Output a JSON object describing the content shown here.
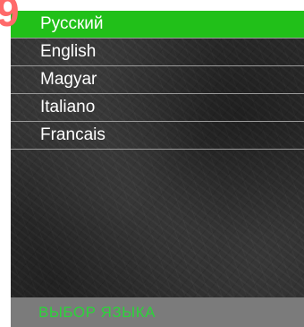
{
  "page_number": "9",
  "languages": [
    {
      "label": "Русский",
      "selected": true
    },
    {
      "label": "English",
      "selected": false
    },
    {
      "label": "Magyar",
      "selected": false
    },
    {
      "label": "Italiano",
      "selected": false
    },
    {
      "label": "Francais",
      "selected": false
    }
  ],
  "footer": {
    "title": "ВЫБОР ЯЗЫКА"
  },
  "colors": {
    "selected_background": "#21c019",
    "footer_background": "#7b7b7b",
    "footer_text": "#2cd43a",
    "page_number": "#ff6a6a"
  }
}
